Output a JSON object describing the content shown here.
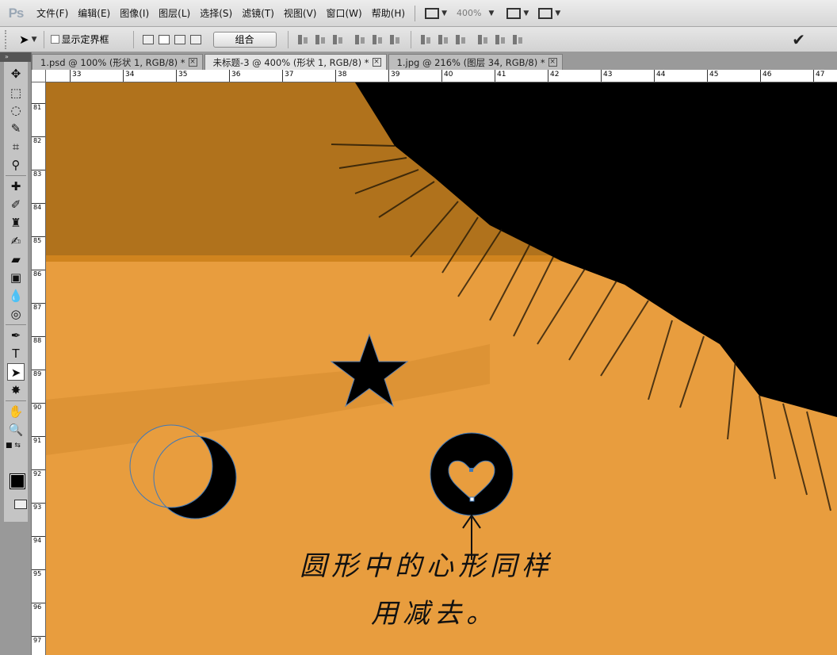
{
  "app": {
    "logo": "Ps"
  },
  "menu": [
    "文件(F)",
    "编辑(E)",
    "图像(I)",
    "图层(L)",
    "选择(S)",
    "滤镜(T)",
    "视图(V)",
    "窗口(W)",
    "帮助(H)"
  ],
  "menubar_tools": {
    "zoom": "400%"
  },
  "options": {
    "show_bounding_box": "显示定界框",
    "combine_button": "组合"
  },
  "tabs": [
    {
      "label": "1.psd @ 100% (形状 1, RGB/8) *",
      "active": false
    },
    {
      "label": "未标题-3 @ 400% (形状 1, RGB/8) *",
      "active": true
    },
    {
      "label": "1.jpg @ 216% (图层 34, RGB/8) *",
      "active": false
    }
  ],
  "ruler": {
    "horizontal": [
      "33",
      "34",
      "35",
      "36",
      "37",
      "38",
      "39",
      "40",
      "41",
      "42",
      "43",
      "44",
      "45",
      "46",
      "47"
    ],
    "vertical": [
      "81",
      "82",
      "83",
      "84",
      "85",
      "86",
      "87",
      "88",
      "89",
      "90",
      "91",
      "92",
      "93",
      "94",
      "95",
      "96",
      "97"
    ]
  },
  "annotation": {
    "line1": "圆形中的心形同样",
    "line2": "用减去。"
  },
  "colors": {
    "canvas_light": "#e89d3e",
    "canvas_dark": "#b0721c",
    "shape_fill": "#000000",
    "path_stroke": "#3f78b8"
  }
}
